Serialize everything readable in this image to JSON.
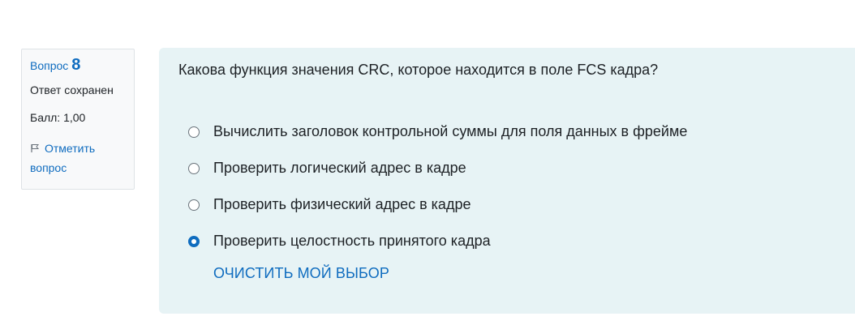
{
  "info": {
    "question_label": "Вопрос",
    "question_number": "8",
    "state": "Ответ сохранен",
    "grade": "Балл: 1,00",
    "flag_label": "Отметить вопрос",
    "flag_icon": "flag-icon"
  },
  "question": {
    "text": "Какова функция значения CRC, которое находится в поле FCS кадра?",
    "options": [
      {
        "label": "Вычислить заголовок контрольной суммы для поля данных в фрейме",
        "selected": false
      },
      {
        "label": "Проверить логический адрес в кадре",
        "selected": false
      },
      {
        "label": "Проверить физический адрес в кадре",
        "selected": false
      },
      {
        "label": "Проверить целостность принятого кадра",
        "selected": true
      }
    ],
    "clear_label": "ОЧИСТИТЬ МОЙ ВЫБОР"
  },
  "colors": {
    "accent": "#0f6cbf",
    "content_bg": "#e7f3f5",
    "info_bg": "#f8f9fa"
  }
}
